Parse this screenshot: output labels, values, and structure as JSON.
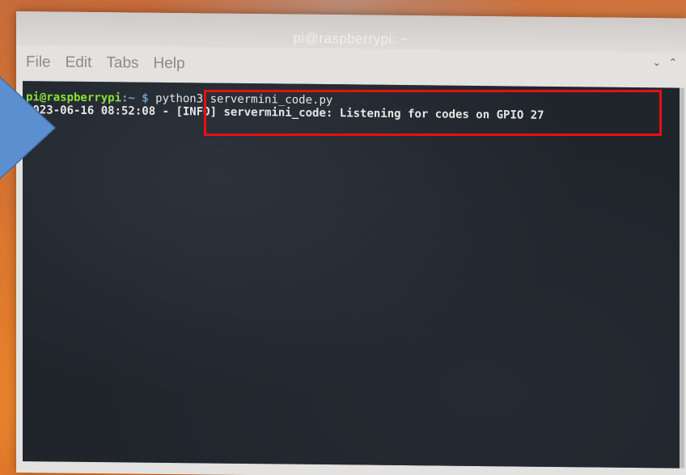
{
  "window": {
    "title": "pi@raspberrypi: ~"
  },
  "menubar": {
    "items": [
      "File",
      "Edit",
      "Tabs",
      "Help"
    ]
  },
  "terminal": {
    "line1": {
      "user": "pi@raspberrypi",
      "path": ":~ $",
      "command": " python3 servermini_code.py"
    },
    "line2": {
      "timestamp": "2023-06-16 08:52:08 -",
      "message": " [INFO] servermini_code: Listening for codes on GPIO 27"
    }
  },
  "icons": {
    "minimize": "chevron-down-icon",
    "maximize": "chevron-up-icon",
    "annotation_arrow": "arrow-right-icon"
  },
  "colors": {
    "highlight_box": "#e81010",
    "annotation_arrow": "#5b8fcf",
    "prompt_user": "#8ae234",
    "prompt_path": "#729fcf",
    "terminal_bg": "#20252c"
  }
}
